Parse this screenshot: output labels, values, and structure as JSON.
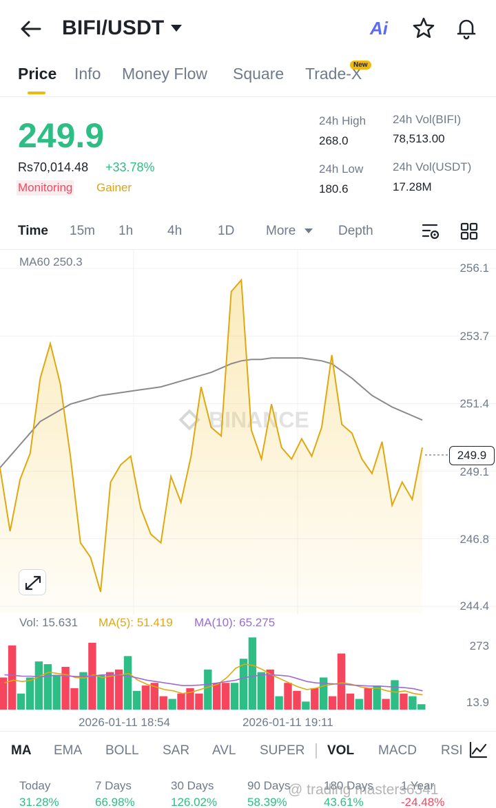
{
  "header": {
    "pair": "BIFI/USDT",
    "ai_label": "Ai"
  },
  "tabs": [
    {
      "label": "Price"
    },
    {
      "label": "Info"
    },
    {
      "label": "Money Flow"
    },
    {
      "label": "Square"
    },
    {
      "label": "Trade-X"
    }
  ],
  "new_badge": "New",
  "price": {
    "last": "249.9",
    "local": "Rs70,014.48",
    "change": "+33.78%",
    "monitoring": "Monitoring",
    "gainer": "Gainer"
  },
  "stats": {
    "high_label": "24h High",
    "high_value": "268.0",
    "low_label": "24h Low",
    "low_value": "180.6",
    "vol_base_label": "24h Vol(BIFI)",
    "vol_base_value": "78,513.00",
    "vol_quote_label": "24h Vol(USDT)",
    "vol_quote_value": "17.28M"
  },
  "timeframes": [
    "Time",
    "15m",
    "1h",
    "4h",
    "1D",
    "More",
    "Depth"
  ],
  "chart": {
    "ma_label": "MA60 250.3",
    "current_price_tag": "249.9",
    "watermark": "BINANCE",
    "price_ticks": [
      "256.1",
      "253.7",
      "251.4",
      "249.1",
      "246.8",
      "244.4"
    ],
    "vol_ticks": [
      "273",
      "13.9"
    ],
    "time_labels": [
      "2026-01-11 18:54",
      "2026-01-11 19:11"
    ],
    "vol_legend": {
      "vol": "Vol: 15.631",
      "ma5": "MA(5): 51.419",
      "ma10": "MA(10): 65.275"
    },
    "colors": {
      "price_line": "#e0a80f",
      "ma60": "#8a8a8a",
      "up": "#2ebd85",
      "down": "#f6465d",
      "ma5": "#e0a80f",
      "ma10": "#9a6bd6"
    }
  },
  "chart_data": {
    "type": "line",
    "ylim": [
      244.4,
      256.1
    ],
    "series": [
      {
        "name": "",
        "values": [
          249.2,
          247.0,
          248.8,
          249.7,
          252.3,
          253.5,
          252.1,
          249.6,
          246.6,
          246.1,
          244.9,
          248.7,
          249.3,
          249.6,
          247.8,
          246.9,
          246.6,
          248.9,
          248.0,
          249.6,
          252.0,
          250.6,
          250.3,
          255.3,
          255.7,
          250.5,
          249.5,
          251.4,
          249.9,
          249.5,
          250.2,
          249.6,
          250.6,
          253.1,
          250.7,
          250.4,
          249.5,
          249.0,
          250.1,
          247.9,
          248.7,
          248.1,
          249.9
        ]
      },
      {
        "name": "MA60",
        "values": [
          249.2,
          249.6,
          250.0,
          250.4,
          250.8,
          251.0,
          251.2,
          251.4,
          251.5,
          251.6,
          251.7,
          251.75,
          251.8,
          251.85,
          251.9,
          251.95,
          252.0,
          252.1,
          252.2,
          252.3,
          252.4,
          252.5,
          252.65,
          252.8,
          252.9,
          252.95,
          252.95,
          253.0,
          253.0,
          253.0,
          253.0,
          252.95,
          252.9,
          252.8,
          252.55,
          252.3,
          252.0,
          251.7,
          251.5,
          251.3,
          251.15,
          251.0,
          250.85
        ]
      }
    ],
    "volume": {
      "ylim": [
        13.9,
        273
      ],
      "bars": [
        {
          "v": 120,
          "dir": "down"
        },
        {
          "v": 240,
          "dir": "down"
        },
        {
          "v": 60,
          "dir": "up"
        },
        {
          "v": 120,
          "dir": "up"
        },
        {
          "v": 180,
          "dir": "up"
        },
        {
          "v": 170,
          "dir": "up"
        },
        {
          "v": 130,
          "dir": "up"
        },
        {
          "v": 160,
          "dir": "down"
        },
        {
          "v": 80,
          "dir": "down"
        },
        {
          "v": 140,
          "dir": "up"
        },
        {
          "v": 250,
          "dir": "down"
        },
        {
          "v": 130,
          "dir": "up"
        },
        {
          "v": 140,
          "dir": "down"
        },
        {
          "v": 150,
          "dir": "down"
        },
        {
          "v": 200,
          "dir": "up"
        },
        {
          "v": 70,
          "dir": "up"
        },
        {
          "v": 90,
          "dir": "down"
        },
        {
          "v": 100,
          "dir": "down"
        },
        {
          "v": 50,
          "dir": "down"
        },
        {
          "v": 40,
          "dir": "up"
        },
        {
          "v": 60,
          "dir": "down"
        },
        {
          "v": 80,
          "dir": "down"
        },
        {
          "v": 60,
          "dir": "down"
        },
        {
          "v": 150,
          "dir": "up"
        },
        {
          "v": 100,
          "dir": "down"
        },
        {
          "v": 100,
          "dir": "down"
        },
        {
          "v": 100,
          "dir": "up"
        },
        {
          "v": 190,
          "dir": "up"
        },
        {
          "v": 270,
          "dir": "up"
        },
        {
          "v": 140,
          "dir": "up"
        },
        {
          "v": 150,
          "dir": "down"
        },
        {
          "v": 50,
          "dir": "up"
        },
        {
          "v": 100,
          "dir": "down"
        },
        {
          "v": 70,
          "dir": "down"
        },
        {
          "v": 30,
          "dir": "up"
        },
        {
          "v": 80,
          "dir": "down"
        },
        {
          "v": 120,
          "dir": "up"
        },
        {
          "v": 50,
          "dir": "down"
        },
        {
          "v": 210,
          "dir": "down"
        },
        {
          "v": 60,
          "dir": "down"
        },
        {
          "v": 40,
          "dir": "up"
        },
        {
          "v": 80,
          "dir": "down"
        },
        {
          "v": 90,
          "dir": "up"
        },
        {
          "v": 40,
          "dir": "down"
        },
        {
          "v": 110,
          "dir": "up"
        },
        {
          "v": 60,
          "dir": "down"
        },
        {
          "v": 50,
          "dir": "up"
        },
        {
          "v": 20,
          "dir": "up"
        }
      ],
      "ma5": [
        100,
        110,
        105,
        110,
        125,
        140,
        135,
        130,
        120,
        118,
        130,
        120,
        125,
        130,
        135,
        110,
        95,
        85,
        75,
        70,
        60,
        65,
        75,
        85,
        95,
        120,
        155,
        170,
        165,
        150,
        130,
        115,
        100,
        85,
        75,
        80,
        90,
        95,
        100,
        95,
        85,
        80,
        80,
        70,
        65,
        70,
        60,
        55
      ],
      "ma10": [
        130,
        128,
        125,
        125,
        122,
        126,
        128,
        126,
        124,
        124,
        126,
        130,
        130,
        128,
        125,
        118,
        110,
        105,
        100,
        95,
        90,
        90,
        92,
        95,
        100,
        105,
        110,
        120,
        125,
        130,
        130,
        128,
        125,
        115,
        105,
        100,
        98,
        96,
        95,
        92,
        90,
        88,
        88,
        86,
        84,
        82,
        78,
        70
      ]
    }
  },
  "indicators": [
    "MA",
    "EMA",
    "BOLL",
    "SAR",
    "AVL",
    "SUPER",
    "VOL",
    "MACD",
    "RSI"
  ],
  "performance": [
    {
      "label": "Today",
      "value": "31.28%",
      "dir": "up"
    },
    {
      "label": "7 Days",
      "value": "66.98%",
      "dir": "up"
    },
    {
      "label": "30 Days",
      "value": "126.02%",
      "dir": "up"
    },
    {
      "label": "90 Days",
      "value": "58.39%",
      "dir": "up"
    },
    {
      "label": "180 Days",
      "value": "43.61%",
      "dir": "up"
    },
    {
      "label": "1 Year",
      "value": "-24.48%",
      "dir": "down"
    }
  ],
  "overlay_watermark": "@ trading masters6341"
}
